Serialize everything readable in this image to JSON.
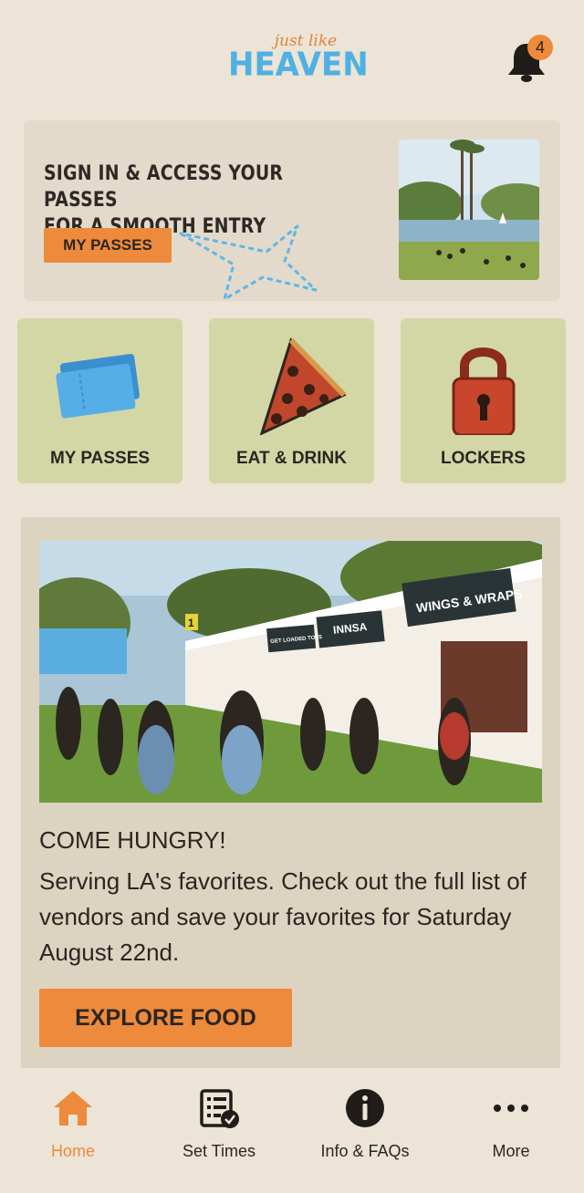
{
  "header": {
    "logo_small": "just like",
    "logo_big": "HEAVEN",
    "notification_count": "4"
  },
  "promo": {
    "title_line1": "SIGN IN & ACCESS YOUR PASSES",
    "title_line2": "FOR A SMOOTH ENTRY",
    "button_label": "MY PASSES"
  },
  "tiles": [
    {
      "label": "MY PASSES",
      "icon": "ticket-icon"
    },
    {
      "label": "EAT & DRINK",
      "icon": "pizza-icon"
    },
    {
      "label": "LOCKERS",
      "icon": "padlock-icon"
    }
  ],
  "feature": {
    "title": "COME HUNGRY!",
    "body": "Serving LA's favorites. Check out the full list of vendors and save your favorites for Saturday August 22nd.",
    "button_label": "EXPLORE FOOD",
    "photo_signs": [
      "WINGS & WRAPS",
      "INNSA",
      "GET LOADED TOTS"
    ],
    "photo_marker": "1"
  },
  "tabbar": {
    "items": [
      {
        "label": "Home",
        "icon": "home-icon",
        "active": true
      },
      {
        "label": "Set Times",
        "icon": "schedule-icon",
        "active": false
      },
      {
        "label": "Info & FAQs",
        "icon": "info-icon",
        "active": false
      },
      {
        "label": "More",
        "icon": "more-icon",
        "active": false
      }
    ]
  },
  "colors": {
    "background": "#ece4d6",
    "accent": "#ee8a3b",
    "tile": "#d3d7a6",
    "logo_blue": "#4fb0e3"
  }
}
